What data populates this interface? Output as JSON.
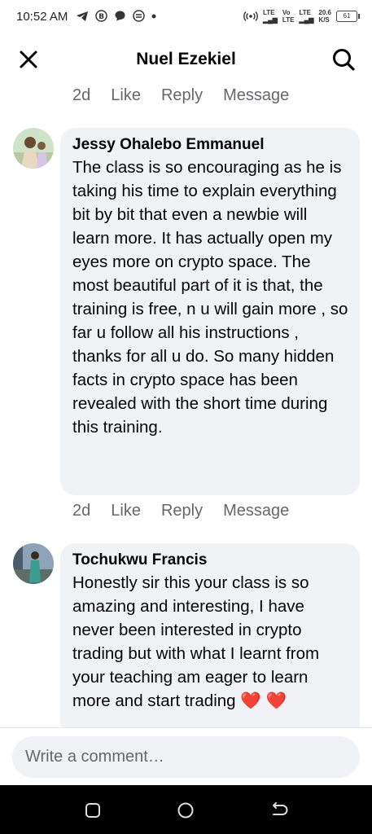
{
  "status": {
    "time": "10:52 AM",
    "net_speed": "20.6",
    "net_unit": "K/S",
    "battery": "61",
    "signal1": "LTE",
    "signal2a": "Vo",
    "signal2b": "LTE",
    "signal3": "LTE"
  },
  "header": {
    "title": "Nuel Ezekiel"
  },
  "actions": {
    "time": "2d",
    "like": "Like",
    "reply": "Reply",
    "message": "Message"
  },
  "comments": [
    {
      "author": "Jessy Ohalebo Emmanuel",
      "text": "The class is so encouraging as he is taking his time to explain everything bit by bit that even a newbie will learn more. It has actually open my eyes more on crypto space. The most beautiful part of it is that, the training is free, n u will gain more , so far u follow all his instructions , thanks for all u do. So many hidden facts in crypto space has been revealed with the short time during this training."
    },
    {
      "author": "Tochukwu Francis",
      "text": "Honestly sir this your class is so amazing and interesting, I have never been interested in crypto trading but with what I learnt from your teaching am eager to learn more and start trading"
    }
  ],
  "heart_emoji": "❤️",
  "compose": {
    "placeholder": "Write a comment…"
  }
}
